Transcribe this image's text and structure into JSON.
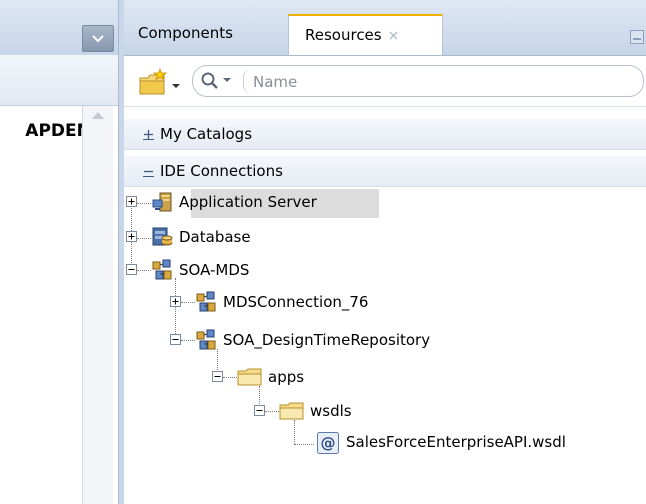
{
  "left_panel": {
    "title": "APDEMO",
    "dropdown_icon": "chevron-down-icon",
    "scroll_icon": "scroll-up-arrow-icon"
  },
  "tabs": [
    {
      "label": "Components",
      "active": false
    },
    {
      "label": "Resources",
      "active": true,
      "close": "×"
    }
  ],
  "toolbar": {
    "new_icon": "new-folder-icon",
    "search_icon": "search-icon",
    "search_placeholder": "Name"
  },
  "sections": {
    "my_catalogs": {
      "label": "My Catalogs",
      "expanded": false,
      "toggle": "+"
    },
    "ide_connections": {
      "label": "IDE Connections",
      "expanded": true,
      "toggle": "−"
    }
  },
  "tree": {
    "application_server": {
      "label": "Application Server",
      "icon": "server-icon",
      "expanded": false,
      "selected": true
    },
    "database": {
      "label": "Database",
      "icon": "database-icon",
      "expanded": false
    },
    "soa_mds": {
      "label": "SOA-MDS",
      "icon": "network-icon",
      "expanded": true
    },
    "mds_connection": {
      "label": "MDSConnection_76",
      "icon": "network-icon",
      "expanded": false
    },
    "soa_design_time": {
      "label": "SOA_DesignTimeRepository",
      "icon": "network-icon",
      "expanded": true
    },
    "apps": {
      "label": "apps",
      "icon": "folder-icon",
      "expanded": true
    },
    "wsdls": {
      "label": "wsdls",
      "icon": "folder-icon",
      "expanded": true
    },
    "wsdl_file": {
      "label": "SalesForceEnterpriseAPI.wsdl",
      "icon": "wsdl-file-icon"
    }
  },
  "colors": {
    "header_gradient_top": "#dfe8f4",
    "header_gradient_bottom": "#c6d5e8",
    "active_tab_accent": "#f0b000",
    "selection": "#dcdcdc"
  }
}
